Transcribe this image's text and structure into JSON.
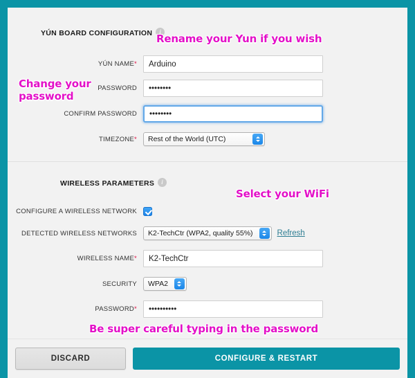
{
  "theme": {
    "accent_teal": "#0b94a6",
    "annotation_magenta": "#e310c8",
    "page_background": "#f2f2f2",
    "link_color": "#2d7d92",
    "control_blue": "#1d84e9"
  },
  "board_section": {
    "title": "YÚN BOARD CONFIGURATION",
    "info_icon": "info-icon",
    "info_glyph": "i",
    "fields": {
      "yun_name": {
        "label": "YÚN NAME",
        "required_marker": "*",
        "value": "Arduino",
        "placeholder": ""
      },
      "password": {
        "label": "PASSWORD",
        "required_marker": "",
        "value": "••••••••",
        "placeholder": ""
      },
      "confirm_password": {
        "label": "CONFIRM PASSWORD",
        "required_marker": "",
        "value": "••••••••",
        "placeholder": "",
        "focused": true
      },
      "timezone": {
        "label": "TIMEZONE",
        "required_marker": "*",
        "selected": "Rest of the World (UTC)"
      }
    }
  },
  "wireless_section": {
    "title": "WIRELESS PARAMETERS",
    "info_icon": "info-icon",
    "info_glyph": "i",
    "fields": {
      "configure_network": {
        "label": "CONFIGURE A WIRELESS NETWORK",
        "required_marker": "",
        "checked": true
      },
      "detected_networks": {
        "label": "DETECTED WIRELESS NETWORKS",
        "required_marker": "",
        "selected": "K2-TechCtr (WPA2, quality 55%)",
        "refresh_label": "Refresh"
      },
      "wireless_name": {
        "label": "WIRELESS NAME",
        "required_marker": "*",
        "value": "K2-TechCtr",
        "placeholder": ""
      },
      "security": {
        "label": "SECURITY",
        "required_marker": "",
        "selected": "WPA2"
      },
      "wifi_password": {
        "label": "PASSWORD",
        "required_marker": "*",
        "value": "••••••••••",
        "placeholder": ""
      }
    }
  },
  "annotations": {
    "rename": "Rename your Yun if you wish",
    "change_password": "Change your\npassword",
    "select_wifi": "Select your WiFi",
    "careful_password": "Be super careful typing in the password"
  },
  "footer": {
    "discard_label": "DISCARD",
    "configure_label": "CONFIGURE & RESTART"
  }
}
